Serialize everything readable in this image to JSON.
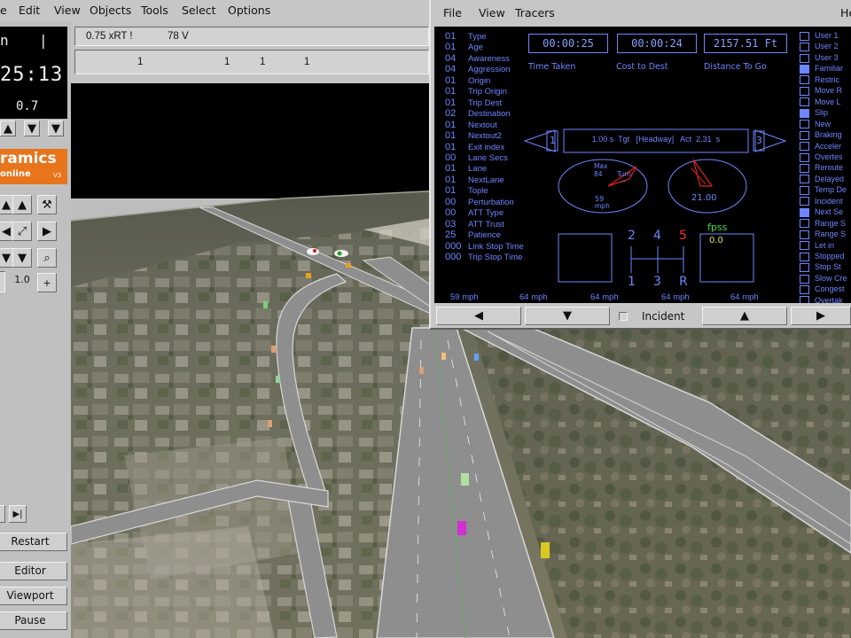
{
  "menubar": {
    "items": [
      "e",
      "Edit",
      "View",
      "Objects",
      "Tools",
      "Select",
      "Options"
    ]
  },
  "left_panel": {
    "lcd_top": "n",
    "lcd_top_right": "|",
    "clock": "25:13",
    "speed_readout": "0.7",
    "logo_text": "ramics",
    "logo_sub": "online",
    "logo_version": "V3",
    "zoom_value": "1.0",
    "plus_label": "+",
    "buttons": {
      "restart": "Restart",
      "editor": "Editor",
      "viewport": "Viewport",
      "pause": "Pause"
    }
  },
  "status": {
    "rate": "0.75 xRT !",
    "vehicles": "78 V",
    "values": [
      "1",
      "1",
      "1",
      "1"
    ]
  },
  "tracer": {
    "menu": [
      "File",
      "View",
      "Tracers"
    ],
    "menu_right": "He",
    "attributes": [
      {
        "num": "01",
        "label": "Type"
      },
      {
        "num": "01",
        "label": "Age"
      },
      {
        "num": "04",
        "label": "Awareness"
      },
      {
        "num": "04",
        "label": "Aggression"
      },
      {
        "num": "01",
        "label": "Origin"
      },
      {
        "num": "01",
        "label": "Trip Origin"
      },
      {
        "num": "01",
        "label": "Trip Dest"
      },
      {
        "num": "02",
        "label": "Destination"
      },
      {
        "num": "01",
        "label": "Nextout"
      },
      {
        "num": "01",
        "label": "Nextout2"
      },
      {
        "num": "01",
        "label": "Exit index"
      },
      {
        "num": "00",
        "label": "Lane Secs"
      },
      {
        "num": "01",
        "label": "Lane"
      },
      {
        "num": "01",
        "label": "NextLane"
      },
      {
        "num": "01",
        "label": "Tople"
      },
      {
        "num": "00",
        "label": "Perturbation"
      },
      {
        "num": "00",
        "label": "ATT Type"
      },
      {
        "num": "03",
        "label": "ATT Trust"
      },
      {
        "num": "25",
        "label": "Patience"
      },
      {
        "num": "000",
        "label": "Link Stop Time"
      },
      {
        "num": "000",
        "label": "Trip Stop Time"
      }
    ],
    "time_taken": {
      "value": "00:00:25",
      "label": "Time Taken"
    },
    "cost_to_dest": {
      "value": "00:00:24",
      "label": "Cost to Dest"
    },
    "distance_to_go": {
      "value": "2157.51 Ft",
      "label": "Distance To Go"
    },
    "headway": {
      "left_num": "1",
      "right_num": "3",
      "text": "1.00 s  Tgt   [Headway]   Act  2.31  s"
    },
    "gauge_left": {
      "top": "Max",
      "top2": "84",
      "right": "Turn",
      "right2": "--",
      "bottom": "59",
      "bottom2": "mph"
    },
    "gauge_right": {
      "value": "21.00"
    },
    "gear": {
      "top": [
        "2",
        "4",
        "5"
      ],
      "bottom": [
        "1",
        "3",
        "R"
      ],
      "active": "5",
      "active_color": "#ff3030"
    },
    "fps_label": "fpss",
    "fps_value": "0.0",
    "speeds": [
      "59 mph",
      "64 mph",
      "64 mph",
      "64 mph",
      "64 mph"
    ],
    "flags": [
      {
        "label": "User 1",
        "on": false
      },
      {
        "label": "User 2",
        "on": false
      },
      {
        "label": "User 3",
        "on": false
      },
      {
        "label": "Familiar",
        "on": true
      },
      {
        "label": "Restric",
        "on": false
      },
      {
        "label": "Move R",
        "on": false
      },
      {
        "label": "Move L",
        "on": false
      },
      {
        "label": "Slip",
        "on": true
      },
      {
        "label": "New",
        "on": false
      },
      {
        "label": "Braking",
        "on": false
      },
      {
        "label": "Acceler",
        "on": false
      },
      {
        "label": "Overtes",
        "on": false
      },
      {
        "label": "Reroute",
        "on": false
      },
      {
        "label": "Delayed",
        "on": false
      },
      {
        "label": "Temp De",
        "on": false
      },
      {
        "label": "Incident",
        "on": false
      },
      {
        "label": "Next Se",
        "on": true
      },
      {
        "label": "Range S",
        "on": false
      },
      {
        "label": "Range S",
        "on": false
      },
      {
        "label": "Let in",
        "on": false
      },
      {
        "label": "Stopped",
        "on": false
      },
      {
        "label": "Stop St",
        "on": false
      },
      {
        "label": "Slow Cre",
        "on": false
      },
      {
        "label": "Congest",
        "on": false
      },
      {
        "label": "Overtak",
        "on": false
      }
    ],
    "bottom": {
      "incident_label": "Incident"
    }
  },
  "colors": {
    "tracer_blue": "#6f86ff",
    "lcd_bg": "#000000",
    "logo_orange": "#e8741c"
  }
}
